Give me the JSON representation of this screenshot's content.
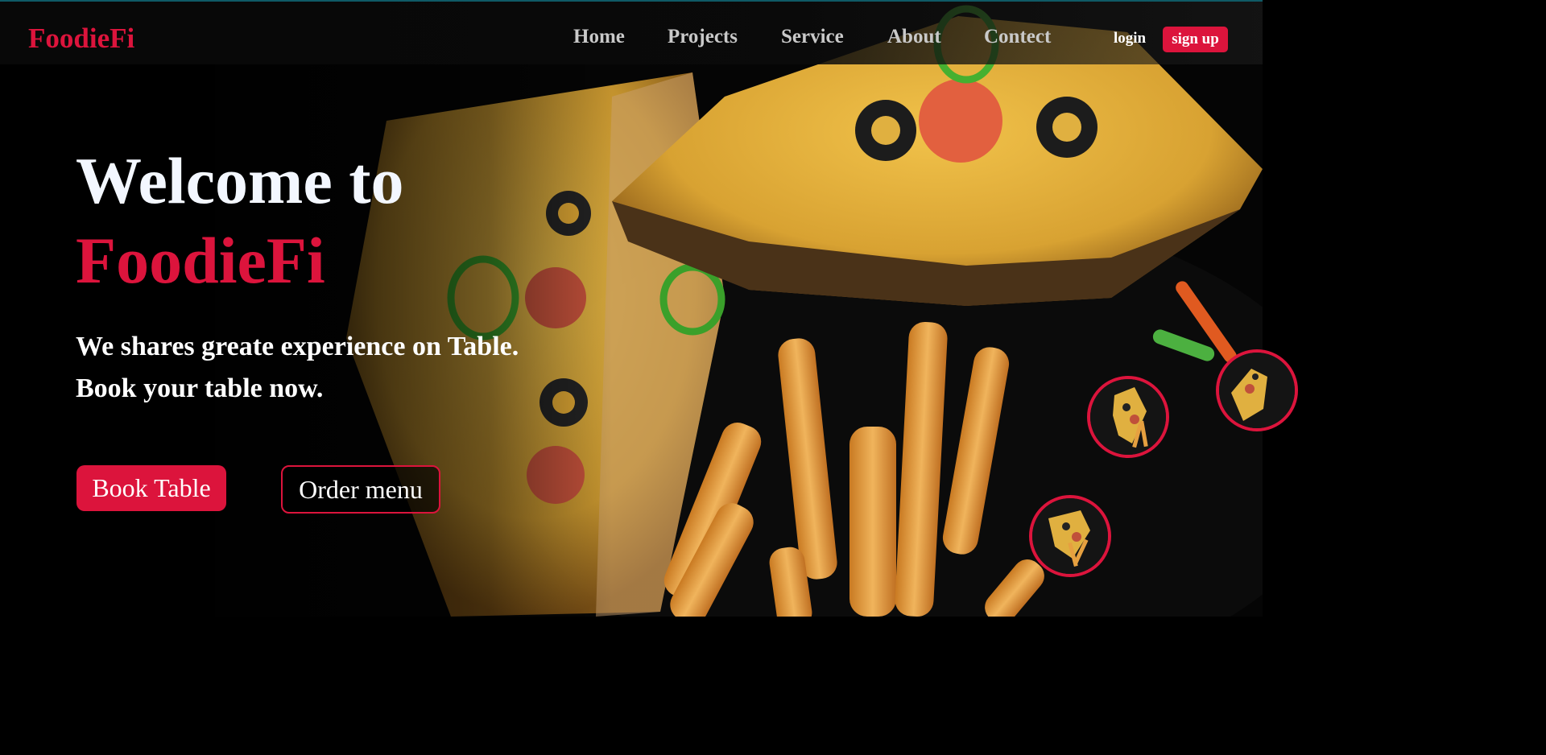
{
  "brand": {
    "name": "FoodieFi",
    "accent_color": "#dc143c"
  },
  "nav": {
    "items": [
      {
        "label": "Home"
      },
      {
        "label": "Projects"
      },
      {
        "label": "Service"
      },
      {
        "label": "About"
      },
      {
        "label": "Contect"
      }
    ],
    "login_label": "login",
    "signup_label": "sign up"
  },
  "hero": {
    "heading_line1": "Welcome to",
    "heading_line2": "FoodieFi",
    "tagline_line1": "We shares greate experience on Table.",
    "tagline_line2": "Book your table now.",
    "primary_button": "Book Table",
    "secondary_button": "Order menu"
  },
  "thumbnails": [
    {
      "icon": "pizza-fries-thumbnail"
    },
    {
      "icon": "pizza-fries-thumbnail"
    },
    {
      "icon": "pizza-fries-thumbnail"
    }
  ]
}
